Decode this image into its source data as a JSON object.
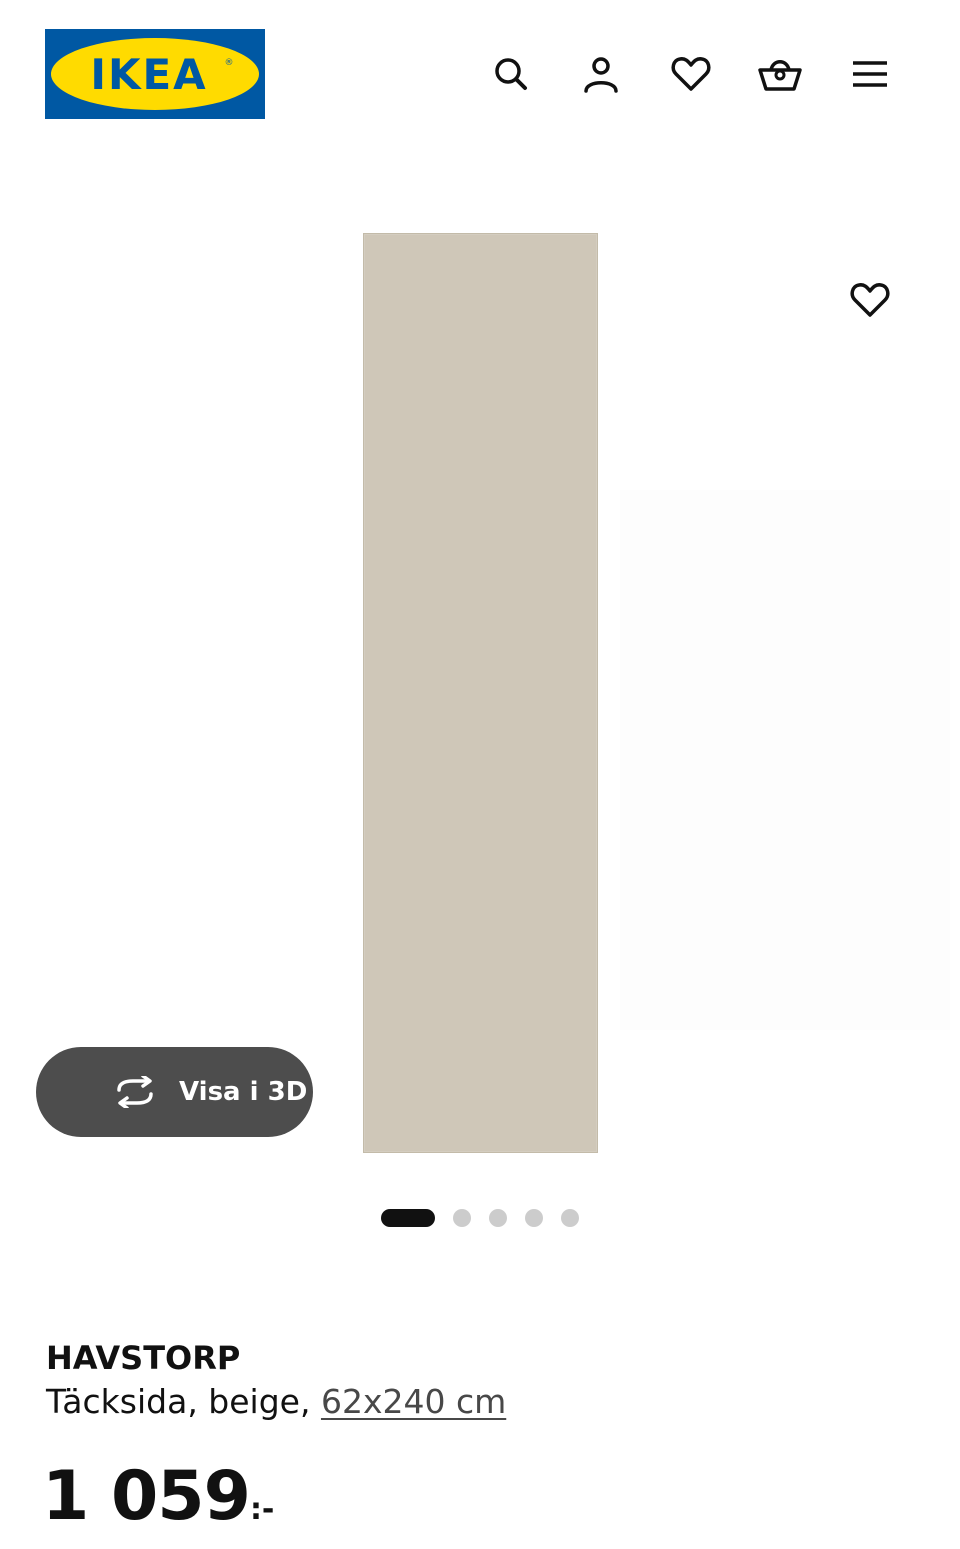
{
  "header": {
    "logo_text": "IKEA",
    "icons": [
      "search-icon",
      "user-icon",
      "heart-icon",
      "basket-icon",
      "menu-icon"
    ]
  },
  "gallery": {
    "image_alt": "HAVSTORP Täcksida, beige",
    "view_3d_label": "Visa i 3D",
    "slide_count": 5,
    "active_slide": 1
  },
  "product": {
    "name": "HAVSTORP",
    "description": "Täcksida, beige, ",
    "size": "62x240 cm",
    "price": "1 059",
    "price_suffix": ":-"
  },
  "colors": {
    "brand_blue": "#0058a3",
    "brand_yellow": "#ffdb00",
    "panel_beige": "#cfc7b8",
    "button_dark": "#4d4d4d"
  }
}
